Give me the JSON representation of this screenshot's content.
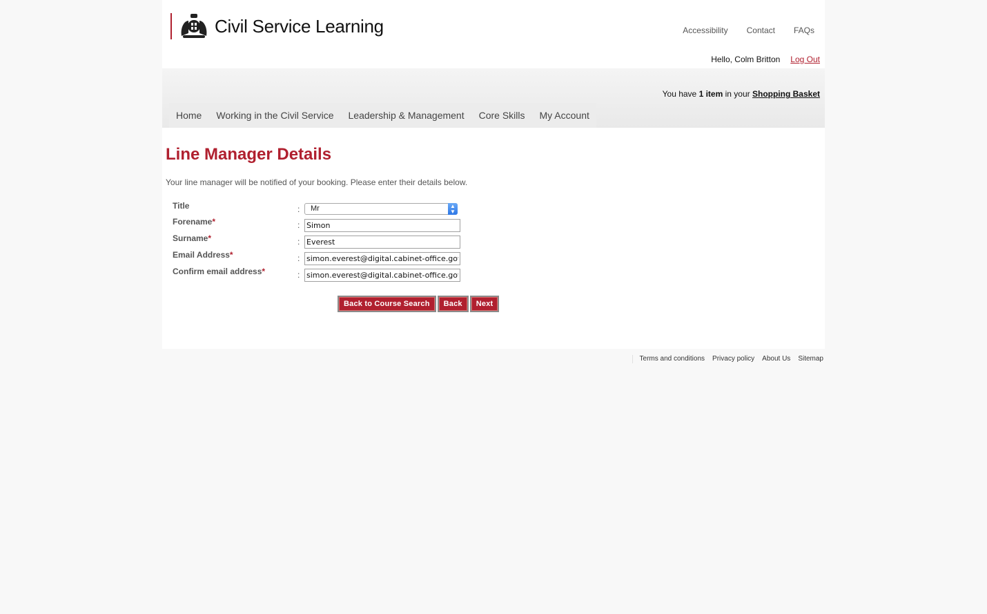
{
  "header": {
    "site_name": "Civil Service Learning",
    "links": [
      "Accessibility",
      "Contact",
      "FAQs"
    ],
    "greeting": "Hello, Colm Britton",
    "logout": "Log Out"
  },
  "basket": {
    "prefix": "You have",
    "count": "1 item",
    "middle": "in your",
    "link": "Shopping Basket"
  },
  "nav": [
    "Home",
    "Working in the Civil Service",
    "Leadership & Management",
    "Core Skills",
    "My Account"
  ],
  "main": {
    "heading": "Line Manager Details",
    "intro": "Your line manager will be notified of your booking. Please enter their details below."
  },
  "form": {
    "title_label": "Title",
    "title_value": "Mr",
    "forename_label": "Forename",
    "forename_value": "Simon",
    "surname_label": "Surname",
    "surname_value": "Everest",
    "email_label": "Email Address",
    "email_value": "simon.everest@digital.cabinet-office.gov.uk",
    "confirm_label": "Confirm email address",
    "confirm_value": "simon.everest@digital.cabinet-office.gov.uk",
    "required_mark": "*",
    "colon": ":"
  },
  "buttons": {
    "back_to_search": "Back to Course Search",
    "back": "Back",
    "next": "Next"
  },
  "footer": [
    "Terms and conditions",
    "Privacy policy",
    "About Us",
    "Sitemap"
  ],
  "colors": {
    "brand_red": "#b0202f",
    "background": "#f8f8f8"
  },
  "icons": {
    "crest": "royal-coat-of-arms-icon",
    "select_arrows": "updown-chevron-icon"
  }
}
